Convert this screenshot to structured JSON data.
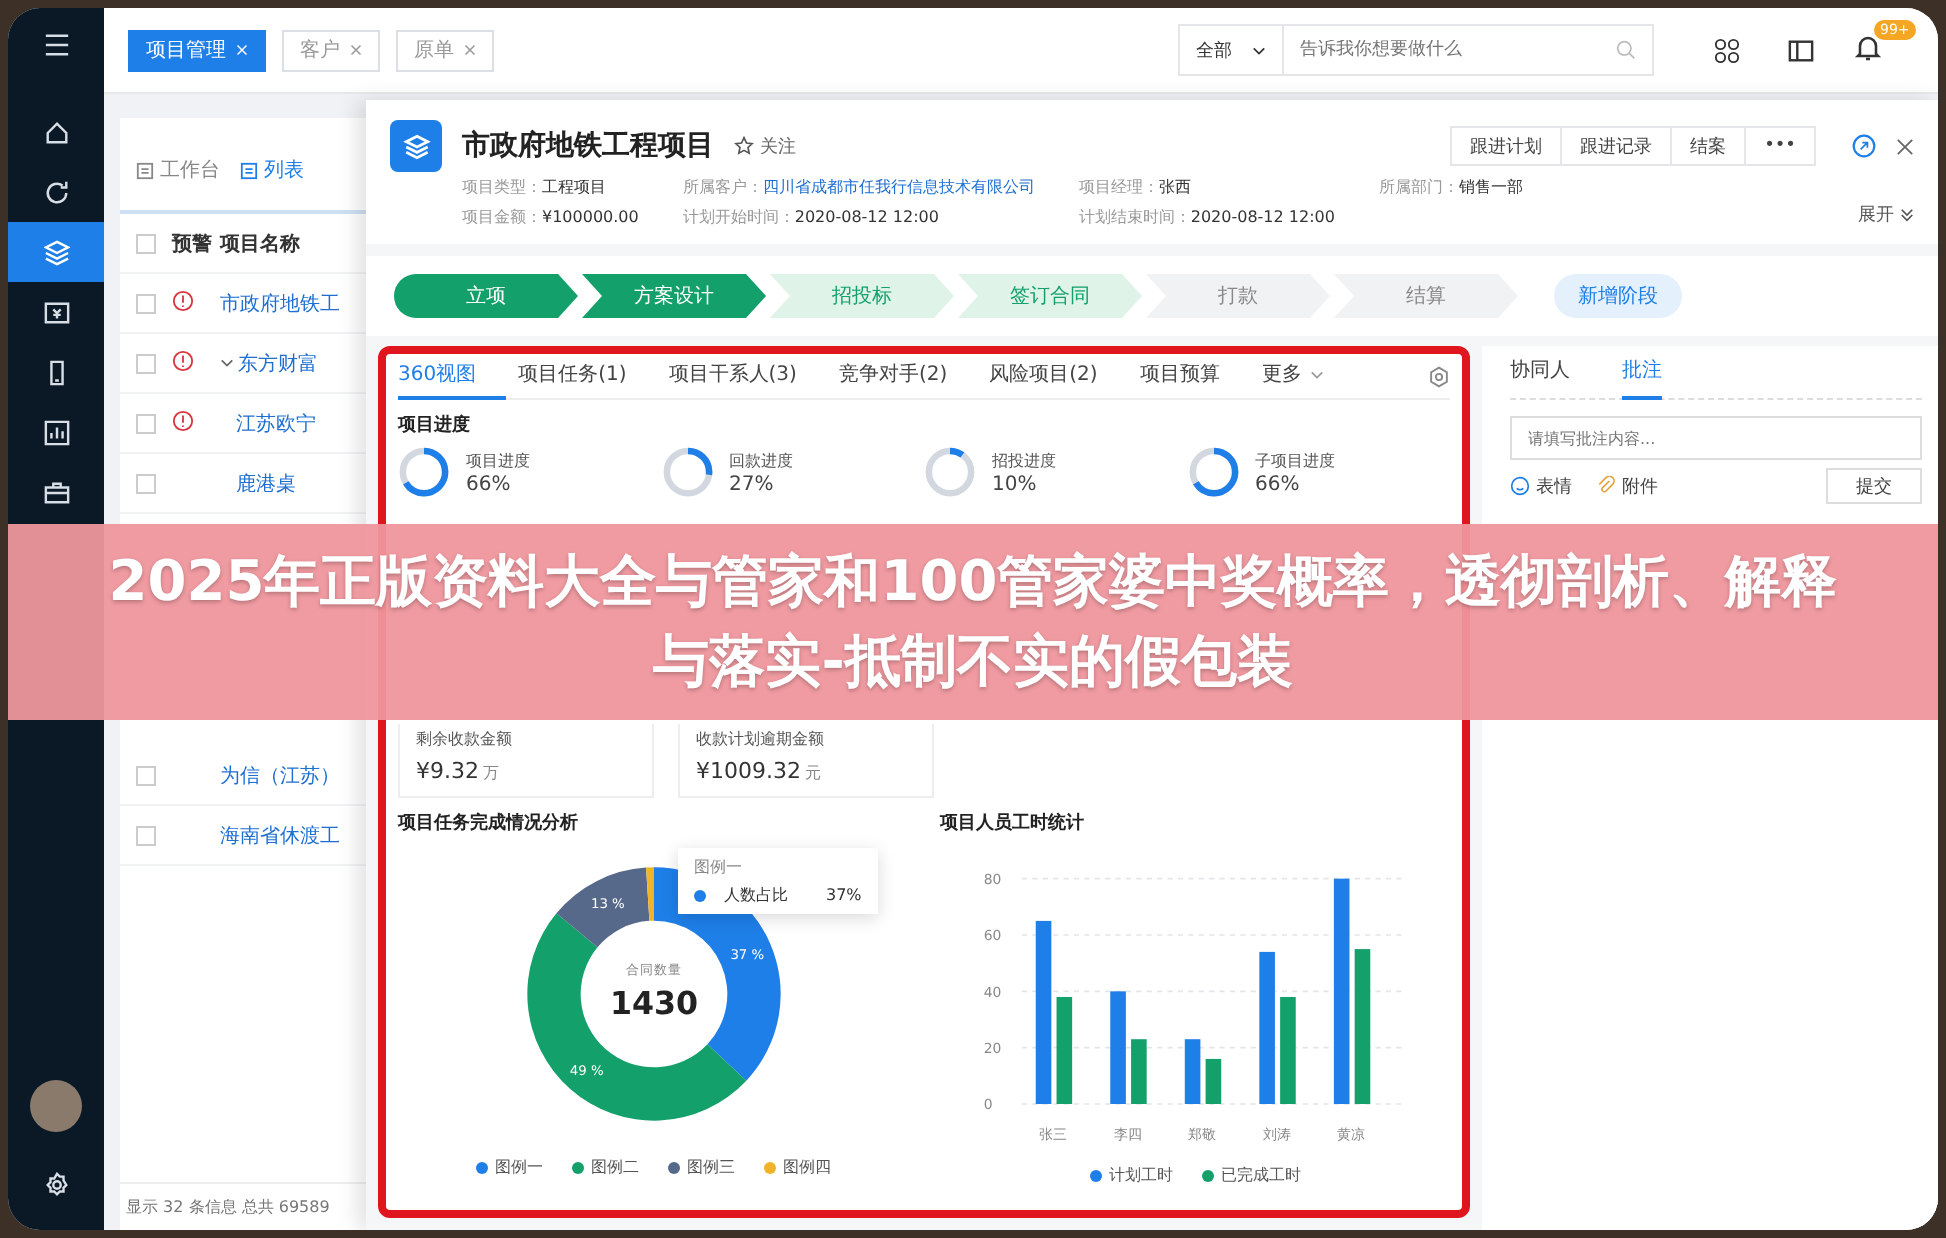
{
  "sidebar": {
    "items": [
      {
        "selected": false
      },
      {
        "selected": false
      },
      {
        "selected": true
      },
      {
        "selected": false
      },
      {
        "selected": false
      },
      {
        "selected": false
      },
      {
        "selected": false
      }
    ]
  },
  "top_tabs": [
    {
      "label": "项目管理",
      "selected": true
    },
    {
      "label": "客户",
      "selected": false
    },
    {
      "label": "原单",
      "selected": false
    }
  ],
  "search": {
    "scope": "全部",
    "placeholder": "告诉我你想要做什么"
  },
  "notifications": {
    "badge": "99+"
  },
  "list": {
    "tabs": [
      {
        "label": "工作台",
        "selected": false
      },
      {
        "label": "列表",
        "selected": true
      }
    ],
    "all_checked": false,
    "columns": [
      "预警",
      "项目名称"
    ],
    "rows": [
      {
        "checked": false,
        "warning": true,
        "name": "市政府地铁工"
      },
      {
        "checked": false,
        "warning": true,
        "name": "东方财富",
        "expanded": true,
        "children": [
          {
            "checked": false,
            "warning": true,
            "name": "江苏欧宁"
          },
          {
            "checked": false,
            "warning": false,
            "name": "鹿港桌"
          }
        ]
      }
    ],
    "rows_below": [
      {
        "checked": false,
        "warning": false,
        "name": "为信（江苏）"
      },
      {
        "checked": false,
        "warning": false,
        "name": "海南省休渡工"
      }
    ],
    "footer": "显示 32 条信息 总共 69589"
  },
  "drawer": {
    "title": "市政府地铁工程项目",
    "follow": "关注",
    "meta": [
      {
        "label": "项目类型：",
        "value": "工程项目",
        "kind": "text"
      },
      {
        "label": "所属客户：",
        "value": "四川省成都市任我行信息技术有限公司",
        "kind": "link"
      },
      {
        "label": "项目经理：",
        "value": "张西",
        "kind": "text"
      },
      {
        "label": "所属部门：",
        "value": "销售一部",
        "kind": "text"
      },
      {
        "label": "项目金额：",
        "value": "¥100000.00",
        "kind": "text"
      },
      {
        "label": "计划开始时间：",
        "value": "2020-08-12  12:00",
        "kind": "text"
      },
      {
        "label": "计划结束时间：",
        "value": "2020-08-12  12:00",
        "kind": "text"
      }
    ],
    "actions": [
      "跟进计划",
      "跟进记录",
      "结案",
      "•••"
    ],
    "expand": "展开",
    "stages": [
      {
        "label": "立项",
        "done": true,
        "active": false
      },
      {
        "label": "方案设计",
        "done": true,
        "active": false
      },
      {
        "label": "招投标",
        "done": false,
        "active": true
      },
      {
        "label": "签订合同",
        "done": false,
        "active": true
      },
      {
        "label": "打款",
        "done": false,
        "active": false
      },
      {
        "label": "结算",
        "done": false,
        "active": false
      }
    ],
    "add_stage": "新增阶段",
    "tabs": [
      {
        "label": "360视图",
        "selected": true
      },
      {
        "label": "项目任务(1)",
        "selected": false
      },
      {
        "label": "项目干系人(3)",
        "selected": false
      },
      {
        "label": "竞争对手(2)",
        "selected": false
      },
      {
        "label": "风险项目(2)",
        "selected": false
      },
      {
        "label": "项目预算",
        "selected": false
      },
      {
        "label": "更多",
        "selected": false
      }
    ],
    "progress_title": "项目进度",
    "progress": [
      {
        "label": "项目进度",
        "value": "66%",
        "level": 0.66
      },
      {
        "label": "回款进度",
        "value": "27%",
        "level": 0.27
      },
      {
        "label": "招投进度",
        "value": "10%",
        "level": 0.1
      },
      {
        "label": "子项目进度",
        "value": "66%",
        "level": 0.66
      }
    ],
    "amounts": [
      {
        "label": "剩余收款金额",
        "value": "¥9.32",
        "unit": "万"
      },
      {
        "label": "收款计划逾期金额",
        "value": "¥1009.32",
        "unit": "元"
      }
    ],
    "donut": {
      "center_label": "合同数量",
      "center_value": "1430",
      "slices": [
        {
          "color": "#1e7fe8"
        },
        {
          "color": "#13a06b"
        },
        {
          "color": "#56698a"
        },
        {
          "color": "#f0b429"
        }
      ],
      "tooltip": {
        "title": "图例一",
        "value": "37%"
      },
      "chart_data": {
        "type": "donut",
        "title": "项目任务完成情况分析",
        "categories": [
          "图例一",
          "图例二",
          "图例三",
          "图例四"
        ],
        "series": [
          {
            "name": "人数占比",
            "values": [
              37,
              49,
              13,
              1
            ]
          }
        ],
        "value_labels": [
          "37 %",
          "49 %",
          "13 %"
        ],
        "legend": "bottom"
      }
    },
    "bars": {
      "chart_data": {
        "type": "bar",
        "title": "项目人员工时统计",
        "categories": [
          "张三",
          "李四",
          "郑敬",
          "刘涛",
          "黄凉"
        ],
        "ylim": [
          0,
          80
        ],
        "yticks": [
          0,
          20,
          40,
          60,
          80
        ],
        "grid": true,
        "legend": "bottom",
        "series": [
          {
            "name": "计划工时",
            "color": "#1e7fe8",
            "values": [
              65,
              40,
              23,
              54,
              80
            ]
          },
          {
            "name": "已完成工时",
            "color": "#13a06b",
            "values": [
              38,
              23,
              16,
              38,
              55
            ]
          }
        ]
      }
    },
    "side": {
      "tabs": [
        {
          "label": "协同人",
          "selected": false
        },
        {
          "label": "批注",
          "selected": true
        }
      ],
      "placeholder": "请填写批注内容...",
      "emoji": "表情",
      "attach": "附件",
      "submit": "提交"
    }
  },
  "banner": "2025年正版资料大全与管家和100管家婆中奖概率，透彻剖析、解释与落实-抵制不实的假包装"
}
